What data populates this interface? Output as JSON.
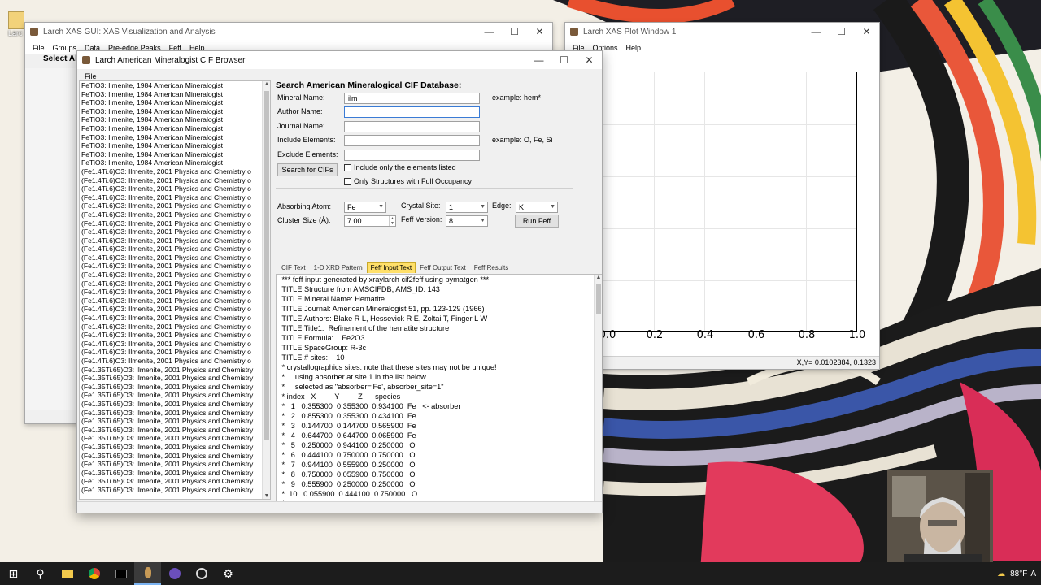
{
  "desktop": {
    "icon_label": "Larc"
  },
  "main_window": {
    "title": "Larch XAS GUI: XAS Visualization and Analysis",
    "menu": [
      "File",
      "Groups",
      "Data",
      "Pre-edge Peaks",
      "Feff",
      "Help"
    ],
    "select_all": "Select All"
  },
  "plot_window": {
    "title": "Larch XAS Plot Window 1",
    "menu": [
      "File",
      "Options",
      "Help"
    ],
    "x_ticks": [
      "0.0",
      "0.2",
      "0.4",
      "0.6",
      "0.8",
      "1.0"
    ],
    "status": "X,Y= 0.0102384, 0.1323"
  },
  "cif_window": {
    "title": "Larch American Mineralogist CIF Browser",
    "menu": [
      "File"
    ],
    "list_items": [
      "FeTiO3: Ilmenite, 1984 American Mineralogist",
      "FeTiO3: Ilmenite, 1984 American Mineralogist",
      "FeTiO3: Ilmenite, 1984 American Mineralogist",
      "FeTiO3: Ilmenite, 1984 American Mineralogist",
      "FeTiO3: Ilmenite, 1984 American Mineralogist",
      "FeTiO3: Ilmenite, 1984 American Mineralogist",
      "FeTiO3: Ilmenite, 1984 American Mineralogist",
      "FeTiO3: Ilmenite, 1984 American Mineralogist",
      "FeTiO3: Ilmenite, 1984 American Mineralogist",
      "FeTiO3: Ilmenite, 1984 American Mineralogist",
      "(Fe1.4Ti.6)O3: Ilmenite, 2001 Physics and Chemistry o",
      "(Fe1.4Ti.6)O3: Ilmenite, 2001 Physics and Chemistry o",
      "(Fe1.4Ti.6)O3: Ilmenite, 2001 Physics and Chemistry o",
      "(Fe1.4Ti.6)O3: Ilmenite, 2001 Physics and Chemistry o",
      "(Fe1.4Ti.6)O3: Ilmenite, 2001 Physics and Chemistry o",
      "(Fe1.4Ti.6)O3: Ilmenite, 2001 Physics and Chemistry o",
      "(Fe1.4Ti.6)O3: Ilmenite, 2001 Physics and Chemistry o",
      "(Fe1.4Ti.6)O3: Ilmenite, 2001 Physics and Chemistry o",
      "(Fe1.4Ti.6)O3: Ilmenite, 2001 Physics and Chemistry o",
      "(Fe1.4Ti.6)O3: Ilmenite, 2001 Physics and Chemistry o",
      "(Fe1.4Ti.6)O3: Ilmenite, 2001 Physics and Chemistry o",
      "(Fe1.4Ti.6)O3: Ilmenite, 2001 Physics and Chemistry o",
      "(Fe1.4Ti.6)O3: Ilmenite, 2001 Physics and Chemistry o",
      "(Fe1.4Ti.6)O3: Ilmenite, 2001 Physics and Chemistry o",
      "(Fe1.4Ti.6)O3: Ilmenite, 2001 Physics and Chemistry o",
      "(Fe1.4Ti.6)O3: Ilmenite, 2001 Physics and Chemistry o",
      "(Fe1.4Ti.6)O3: Ilmenite, 2001 Physics and Chemistry o",
      "(Fe1.4Ti.6)O3: Ilmenite, 2001 Physics and Chemistry o",
      "(Fe1.4Ti.6)O3: Ilmenite, 2001 Physics and Chemistry o",
      "(Fe1.4Ti.6)O3: Ilmenite, 2001 Physics and Chemistry o",
      "(Fe1.4Ti.6)O3: Ilmenite, 2001 Physics and Chemistry o",
      "(Fe1.4Ti.6)O3: Ilmenite, 2001 Physics and Chemistry o",
      "(Fe1.4Ti.6)O3: Ilmenite, 2001 Physics and Chemistry o",
      "(Fe1.35Ti.65)O3: Ilmenite, 2001 Physics and Chemistry",
      "(Fe1.35Ti.65)O3: Ilmenite, 2001 Physics and Chemistry",
      "(Fe1.35Ti.65)O3: Ilmenite, 2001 Physics and Chemistry",
      "(Fe1.35Ti.65)O3: Ilmenite, 2001 Physics and Chemistry",
      "(Fe1.35Ti.65)O3: Ilmenite, 2001 Physics and Chemistry",
      "(Fe1.35Ti.65)O3: Ilmenite, 2001 Physics and Chemistry",
      "(Fe1.35Ti.65)O3: Ilmenite, 2001 Physics and Chemistry",
      "(Fe1.35Ti.65)O3: Ilmenite, 2001 Physics and Chemistry",
      "(Fe1.35Ti.65)O3: Ilmenite, 2001 Physics and Chemistry",
      "(Fe1.35Ti.65)O3: Ilmenite, 2001 Physics and Chemistry",
      "(Fe1.35Ti.65)O3: Ilmenite, 2001 Physics and Chemistry",
      "(Fe1.35Ti.65)O3: Ilmenite, 2001 Physics and Chemistry",
      "(Fe1.35Ti.65)O3: Ilmenite, 2001 Physics and Chemistry",
      "(Fe1.35Ti.65)O3: Ilmenite, 2001 Physics and Chemistry",
      "(Fe1.35Ti.65)O3: Ilmenite, 2001 Physics and Chemistry"
    ],
    "search": {
      "heading": "Search American Mineralogical CIF Database:",
      "mineral_label": "Mineral Name:",
      "mineral_value": "ilm",
      "mineral_example": "example: hem*",
      "author_label": "Author Name:",
      "author_value": "",
      "journal_label": "Journal Name:",
      "journal_value": "",
      "include_label": "Include Elements:",
      "include_value": "",
      "include_example": "example: O, Fe, Si",
      "exclude_label": "Exclude Elements:",
      "exclude_value": "",
      "search_button": "Search for CIFs",
      "only_listed": "Include only the elements listed",
      "full_occupancy": "Only Structures with Full Occupancy"
    },
    "feff": {
      "absorbing_label": "Absorbing Atom:",
      "absorbing_value": "Fe",
      "site_label": "Crystal Site:",
      "site_value": "1",
      "edge_label": "Edge:",
      "edge_value": "K",
      "cluster_label": "Cluster Size (Å):",
      "cluster_value": "7.00",
      "version_label": "Feff Version:",
      "version_value": "8",
      "run_button": "Run Feff"
    },
    "tabs": [
      "CIF Text",
      "1-D XRD Pattern",
      "Feff Input Text",
      "Feff Output Text",
      "Feff Results"
    ],
    "active_tab": "Feff Input Text",
    "feff_text": [
      " *** feff input generated by xraylarch cif2feff using pymatgen ***",
      " TITLE Structure from AMSCIFDB, AMS_ID: 143",
      " TITLE Mineral Name: Hematite",
      " TITLE Journal: American Mineralogist 51, pp. 123-129 (1966)",
      " TITLE Authors: Blake R L, Hessevick R E, Zoltai T, Finger L W",
      " TITLE Title1:  Refinement of the hematite structure",
      " TITLE Formula:    Fe2O3",
      " TITLE SpaceGroup: R-3c",
      " TITLE # sites:    10",
      " * crystallographics sites: note that these sites may not be unique!",
      " *     using absorber at site 1 in the list below",
      " *     selected as \"absorber='Fe', absorber_site=1\"",
      " * index   X         Y         Z      species",
      " *   1   0.355300  0.355300  0.934100  Fe   <- absorber",
      " *   2   0.855300  0.355300  0.434100  Fe",
      " *   3   0.144700  0.144700  0.565900  Fe",
      " *   4   0.644700  0.644700  0.065900  Fe",
      " *   5   0.250000  0.944100  0.250000   O",
      " *   6   0.444100  0.750000  0.750000   O",
      " *   7   0.944100  0.555900  0.250000   O",
      " *   8   0.750000  0.055900  0.750000   O",
      " *   9   0.555900  0.250000  0.250000   O",
      " *  10   0.055900  0.444100  0.750000   O",
      " *"
    ]
  },
  "taskbar": {
    "temperature": "88°F",
    "accent": "#7cb4f2"
  }
}
